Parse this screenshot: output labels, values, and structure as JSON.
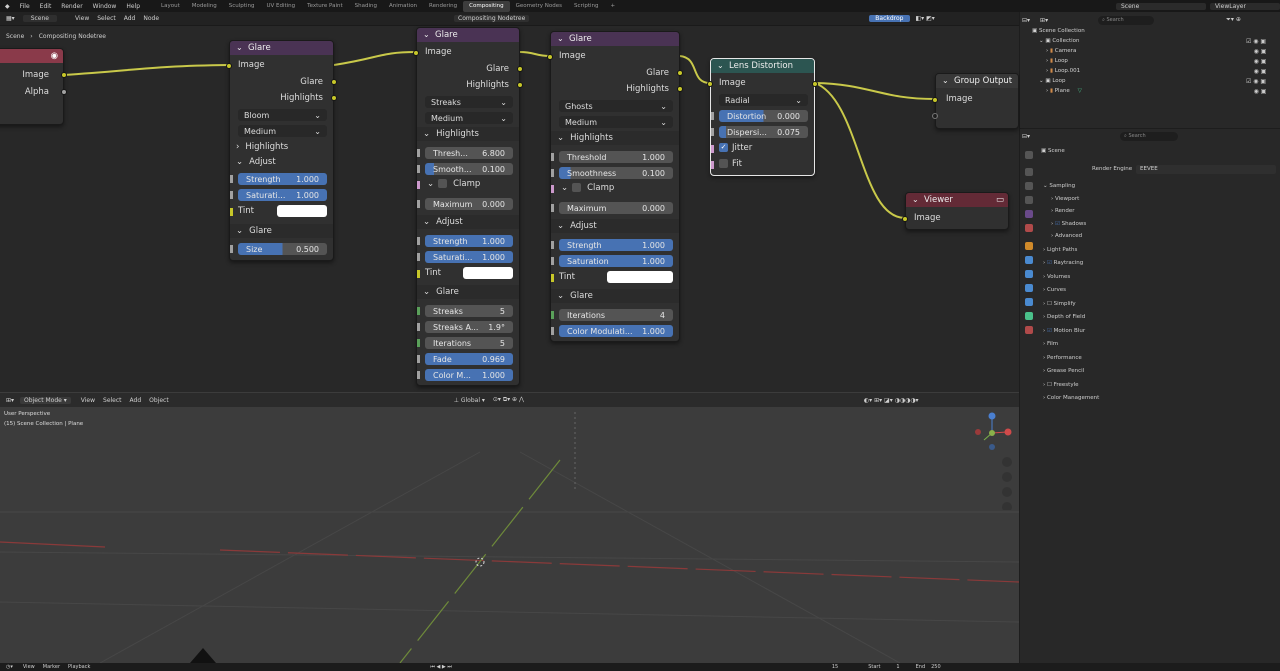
{
  "topbar": {
    "menus": [
      "File",
      "Edit",
      "Render",
      "Window",
      "Help"
    ],
    "workspaces": [
      "Layout",
      "Modeling",
      "Sculpting",
      "UV Editing",
      "Texture Paint",
      "Shading",
      "Animation",
      "Rendering",
      "Compositing",
      "Geometry Nodes",
      "Scripting"
    ],
    "active_workspace": "Compositing",
    "scene": "Scene",
    "viewlayer": "ViewLayer",
    "add_tab": "+"
  },
  "node_editor": {
    "header_menus": [
      "View",
      "Select",
      "Add",
      "Node"
    ],
    "scene_label": "Scene",
    "tree_name": "Compositing Nodetree",
    "backdrop": "Backdrop",
    "breadcrumb": [
      "Scene",
      "Compositing Nodetree"
    ],
    "source_node": {
      "image": "Image",
      "alpha": "Alpha"
    },
    "glare1": {
      "title": "Glare",
      "in_image": "Image",
      "out_glare": "Glare",
      "out_highlights": "Highlights",
      "type": "Bloom",
      "quality": "Medium",
      "highlights": "Highlights",
      "adjust": "Adjust",
      "strength_label": "Strength",
      "strength": "1.000",
      "saturation_label": "Saturati...",
      "saturation": "1.000",
      "tint": "Tint",
      "glare_sect": "Glare",
      "size_label": "Size",
      "size": "0.500"
    },
    "glare2": {
      "title": "Glare",
      "in_image": "Image",
      "out_glare": "Glare",
      "out_highlights": "Highlights",
      "type": "Streaks",
      "quality": "Medium",
      "highlights": "Highlights",
      "thresh_label": "Thresh...",
      "thresh": "6.800",
      "smooth_label": "Smooth...",
      "smooth": "0.100",
      "clamp": "Clamp",
      "max_label": "Maximum",
      "max": "0.000",
      "adjust": "Adjust",
      "strength_label": "Strength",
      "strength": "1.000",
      "saturation_label": "Saturati...",
      "saturation": "1.000",
      "tint": "Tint",
      "glare_sect": "Glare",
      "streaks_label": "Streaks",
      "streaks": "5",
      "angle_label": "Streaks A...",
      "angle": "1.9°",
      "iter_label": "Iterations",
      "iter": "5",
      "fade_label": "Fade",
      "fade": "0.969",
      "color_label": "Color M...",
      "color": "1.000"
    },
    "glare3": {
      "title": "Glare",
      "in_image": "Image",
      "out_glare": "Glare",
      "out_highlights": "Highlights",
      "type": "Ghosts",
      "quality": "Medium",
      "highlights": "Highlights",
      "thresh_label": "Threshold",
      "thresh": "1.000",
      "smooth_label": "Smoothness",
      "smooth": "0.100",
      "clamp": "Clamp",
      "max_label": "Maximum",
      "max": "0.000",
      "adjust": "Adjust",
      "strength_label": "Strength",
      "strength": "1.000",
      "saturation_label": "Saturation",
      "saturation": "1.000",
      "tint": "Tint",
      "glare_sect": "Glare",
      "iter_label": "Iterations",
      "iter": "4",
      "color_label": "Color Modulati...",
      "color": "1.000"
    },
    "lens": {
      "title": "Lens Distortion",
      "in_image": "Image",
      "type": "Radial",
      "dist_label": "Distortion",
      "dist": "0.000",
      "disp_label": "Dispersi...",
      "disp": "0.075",
      "jitter": "Jitter",
      "fit": "Fit"
    },
    "group_output": {
      "title": "Group Output",
      "image": "Image"
    },
    "viewer": {
      "title": "Viewer",
      "image": "Image"
    }
  },
  "viewport": {
    "mode": "Object Mode",
    "menus": [
      "View",
      "Select",
      "Add",
      "Object"
    ],
    "transform": "Global",
    "perspective": "User Perspective",
    "collection": "(15) Scene Collection | Plane"
  },
  "outliner": {
    "search": "Search",
    "items": [
      "Scene Collection",
      "Collection",
      "Camera",
      "Loop",
      "Loop.001",
      "Loop",
      "Plane"
    ]
  },
  "properties": {
    "search": "Search",
    "scene": "Scene",
    "render_engine_label": "Render Engine",
    "render_engine": "EEVEE",
    "sections": [
      "Sampling",
      "Viewport",
      "Render",
      "Shadows",
      "Advanced",
      "Light Paths",
      "Raytracing",
      "Volumes",
      "Curves",
      "Simplify",
      "Depth of Field",
      "Motion Blur",
      "Film",
      "Performance",
      "Grease Pencil",
      "Freestyle",
      "Color Management"
    ]
  },
  "timeline": {
    "menus": [
      "View",
      "Marker",
      "Playback"
    ],
    "frame": "15",
    "start_label": "Start",
    "start": "1",
    "end_label": "End",
    "end": "250"
  },
  "colors": {
    "socket": "#c7c729",
    "blue_field": "#4772b3",
    "glare_header": "#4a3354",
    "lens_header": "#2c5551"
  }
}
